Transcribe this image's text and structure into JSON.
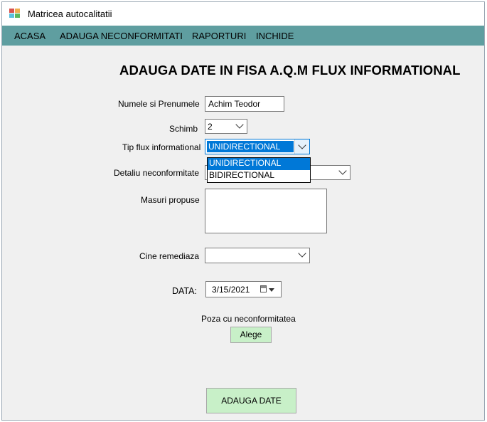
{
  "window": {
    "title": "Matricea autocalitatii"
  },
  "menu": {
    "items": [
      "ACASA",
      "ADAUGA NECONFORMITATI",
      "RAPORTURI",
      "INCHIDE"
    ]
  },
  "form": {
    "heading": "ADAUGA DATE IN FISA A.Q.M FLUX INFORMATIONAL",
    "name_label": "Numele si Prenumele",
    "name_value": "Achim Teodor",
    "shift_label": "Schimb",
    "shift_value": "2",
    "flow_label": "Tip flux informational",
    "flow_value": "UNIDIRECTIONAL",
    "flow_options": [
      "UNIDIRECTIONAL",
      "BIDIRECTIONAL"
    ],
    "detail_label": "Detaliu neconformitate",
    "measures_label": "Masuri propuse",
    "remedy_label": "Cine remediaza",
    "date_label": "DATA:",
    "date_value": "3/15/2021",
    "photo_label": "Poza cu neconformitatea",
    "choose_button": "Alege",
    "submit_button": "ADAUGA DATE"
  },
  "colors": {
    "menubar": "#5f9ea0",
    "button_bg": "#c8f0c8",
    "selection": "#0078d7"
  }
}
